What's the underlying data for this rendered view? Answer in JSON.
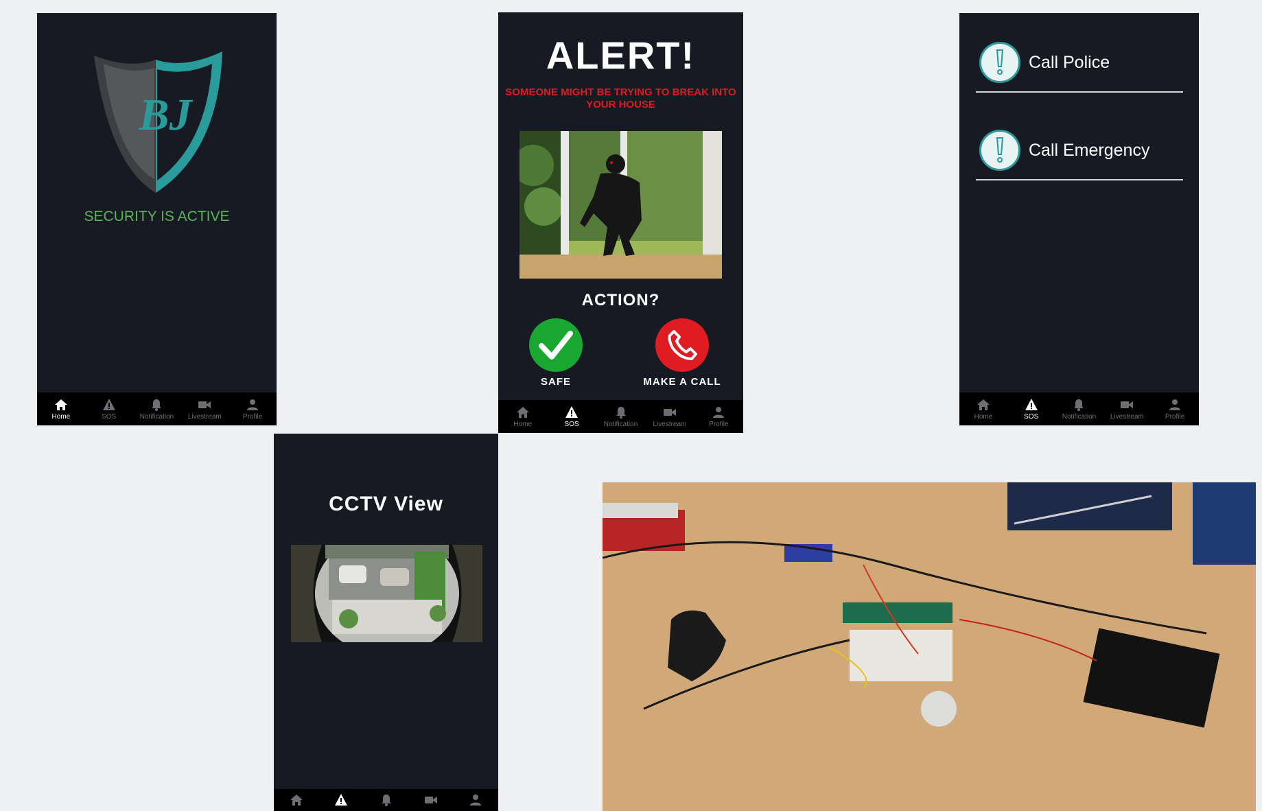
{
  "nav": {
    "home": "Home",
    "sos": "SOS",
    "notification": "Notification",
    "livestream": "Livestream",
    "profile": "Profile"
  },
  "home_screen": {
    "logo_text": "BJ",
    "status": "SECURITY IS ACTIVE"
  },
  "alert_screen": {
    "title": "ALERT!",
    "subtitle": "SOMEONE MIGHT BE TRYING TO BREAK INTO YOUR HOUSE",
    "question": "ACTION?",
    "safe_label": "SAFE",
    "call_label": "MAKE A CALL"
  },
  "sos_screen": {
    "items": [
      {
        "label": "Call Police"
      },
      {
        "label": "Call Emergency"
      }
    ]
  },
  "cctv_screen": {
    "title": "CCTV View"
  },
  "colors": {
    "phone_bg": "#171a22",
    "page_bg": "#eef0f4",
    "accent_teal": "#2a9b9b",
    "status_green": "#58b55a",
    "alert_red": "#e01a1f",
    "safe_green": "#18a832"
  }
}
